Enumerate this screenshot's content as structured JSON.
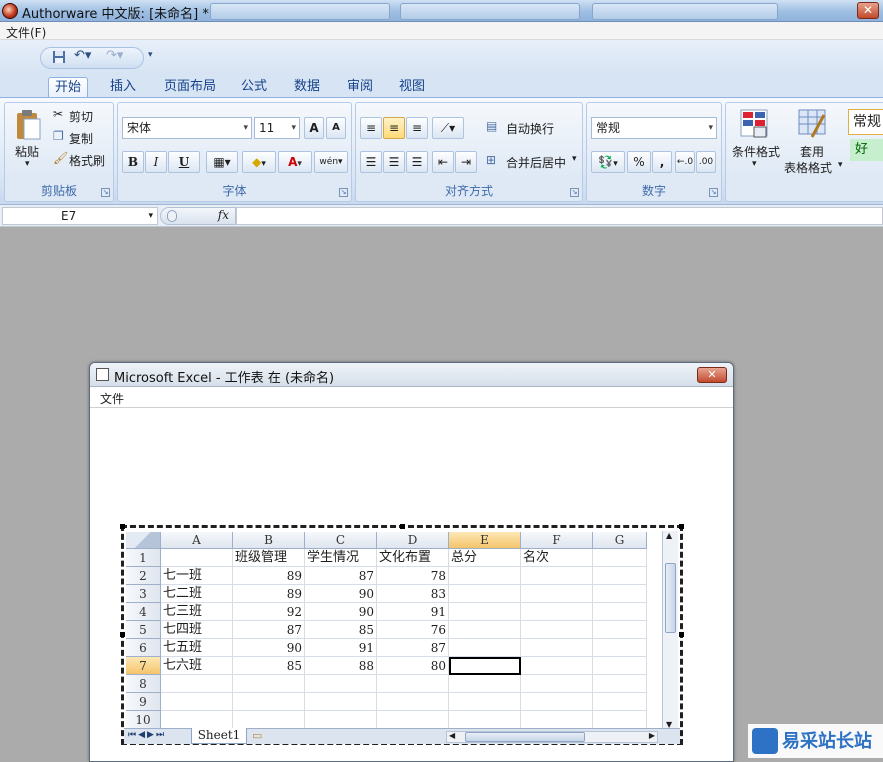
{
  "window": {
    "title": "Authorware 中文版: [未命名] *"
  },
  "menubar": {
    "file": "文件(F)"
  },
  "ribbon": {
    "tabs": [
      "开始",
      "插入",
      "页面布局",
      "公式",
      "数据",
      "审阅",
      "视图"
    ],
    "clipboard": {
      "paste": "粘贴",
      "cut": "剪切",
      "copy": "复制",
      "format_painter": "格式刷",
      "label": "剪贴板"
    },
    "font": {
      "font_name": "宋体",
      "font_size": "11",
      "label": "字体",
      "bold": "B",
      "italic": "I",
      "underline": "U",
      "grow": "A",
      "shrink": "A",
      "color_a": "A",
      "phonetic": "wén"
    },
    "alignment": {
      "wrap_text": "自动换行",
      "merge_center": "合并后居中",
      "label": "对齐方式"
    },
    "number": {
      "format": "常规",
      "label": "数字",
      "percent": "%",
      "comma": ","
    },
    "styles": {
      "conditional_format": "条件格式",
      "table_format_line1": "套用",
      "table_format_line2": "表格格式",
      "style_normal": "常规",
      "style_good": "好"
    }
  },
  "formula_bar": {
    "name_box": "E7",
    "fx": "fx"
  },
  "dialog": {
    "title": "Microsoft Excel - 工作表 在 (未命名)",
    "menu": "文件"
  },
  "sheet": {
    "columns": [
      "A",
      "B",
      "C",
      "D",
      "E",
      "F",
      "G"
    ],
    "rows": [
      "1",
      "2",
      "3",
      "4",
      "5",
      "6",
      "7",
      "8",
      "9",
      "10"
    ],
    "header_row": [
      "",
      "班级管理",
      "学生情况",
      "文化布置",
      "总分",
      "名次",
      ""
    ],
    "data": [
      {
        "class": "七一班",
        "b": "89",
        "c": "87",
        "d": "78"
      },
      {
        "class": "七二班",
        "b": "89",
        "c": "90",
        "d": "83"
      },
      {
        "class": "七三班",
        "b": "92",
        "c": "90",
        "d": "91"
      },
      {
        "class": "七四班",
        "b": "87",
        "c": "85",
        "d": "76"
      },
      {
        "class": "七五班",
        "b": "90",
        "c": "91",
        "d": "87"
      },
      {
        "class": "七六班",
        "b": "85",
        "c": "88",
        "d": "80"
      }
    ],
    "active_cell": "E7",
    "sheet_tab": "Sheet1"
  },
  "watermark": {
    "text": "易采站长站"
  }
}
